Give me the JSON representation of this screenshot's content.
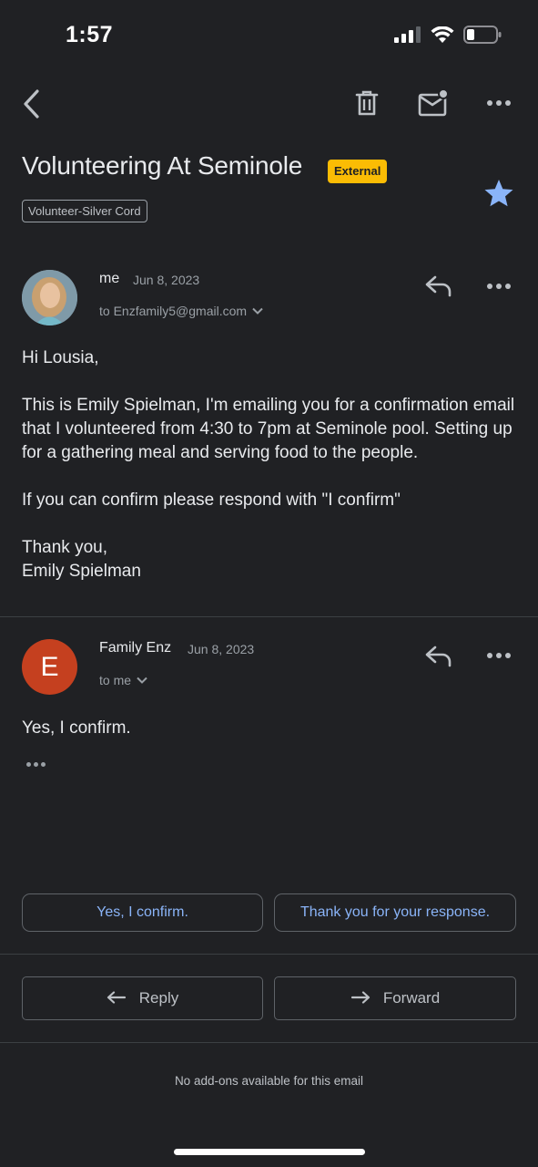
{
  "status_bar": {
    "time": "1:57"
  },
  "subject": {
    "title": "Volunteering At Seminole",
    "badge": "External",
    "label": "Volunteer-Silver Cord"
  },
  "messages": [
    {
      "sender": "me",
      "date": "Jun 8, 2023",
      "recipients": "to Enzfamily5@gmail.com",
      "body": [
        "Hi Lousia,",
        "This is Emily Spielman, I'm emailing you for a confirmation email that I volunteered from 4:30 to 7pm at Seminole pool. Setting up for a gathering meal and serving food to the people.",
        "If you can confirm please respond with \"I confirm\"",
        "Thank you,\nEmily Spielman"
      ]
    },
    {
      "sender": "Family Enz",
      "avatar_letter": "E",
      "date": "Jun 8, 2023",
      "recipients": "to me",
      "body": [
        "Yes, I confirm."
      ]
    }
  ],
  "smart_replies": [
    "Yes, I confirm.",
    "Thank you for your response."
  ],
  "actions": {
    "reply": "Reply",
    "forward": "Forward"
  },
  "footer": {
    "addons": "No add-ons available for this email"
  },
  "colors": {
    "background": "#202124",
    "accent": "#8ab4f8",
    "badge": "#fbbc04",
    "star": "#8ab4f8",
    "avatar_e": "#c5401f"
  },
  "icons": [
    "back-icon",
    "trash-icon",
    "mark-unread-icon",
    "more-icon",
    "star-icon",
    "reply-icon",
    "forward-icon",
    "chevron-down-icon"
  ]
}
